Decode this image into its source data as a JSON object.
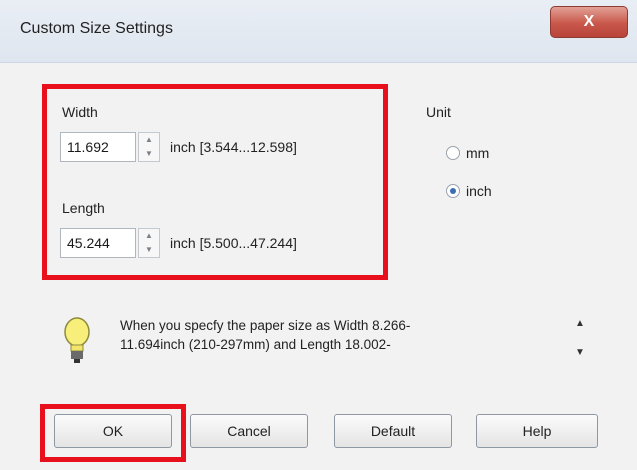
{
  "window": {
    "title": "Custom Size Settings",
    "close_label": "X"
  },
  "width": {
    "label": "Width",
    "value": "11.692",
    "range": "inch [3.544...12.598]"
  },
  "length": {
    "label": "Length",
    "value": "45.244",
    "range": "inch [5.500...47.244]"
  },
  "unit": {
    "label": "Unit",
    "options": [
      {
        "label": "mm",
        "selected": false
      },
      {
        "label": "inch",
        "selected": true
      }
    ]
  },
  "message": {
    "line1": "When you specfy the paper size as Width 8.266-",
    "line2": "11.694inch (210-297mm) and Length 18.002-"
  },
  "buttons": {
    "ok": "OK",
    "cancel": "Cancel",
    "default": "Default",
    "help": "Help"
  },
  "colors": {
    "highlight": "#e8101c"
  }
}
